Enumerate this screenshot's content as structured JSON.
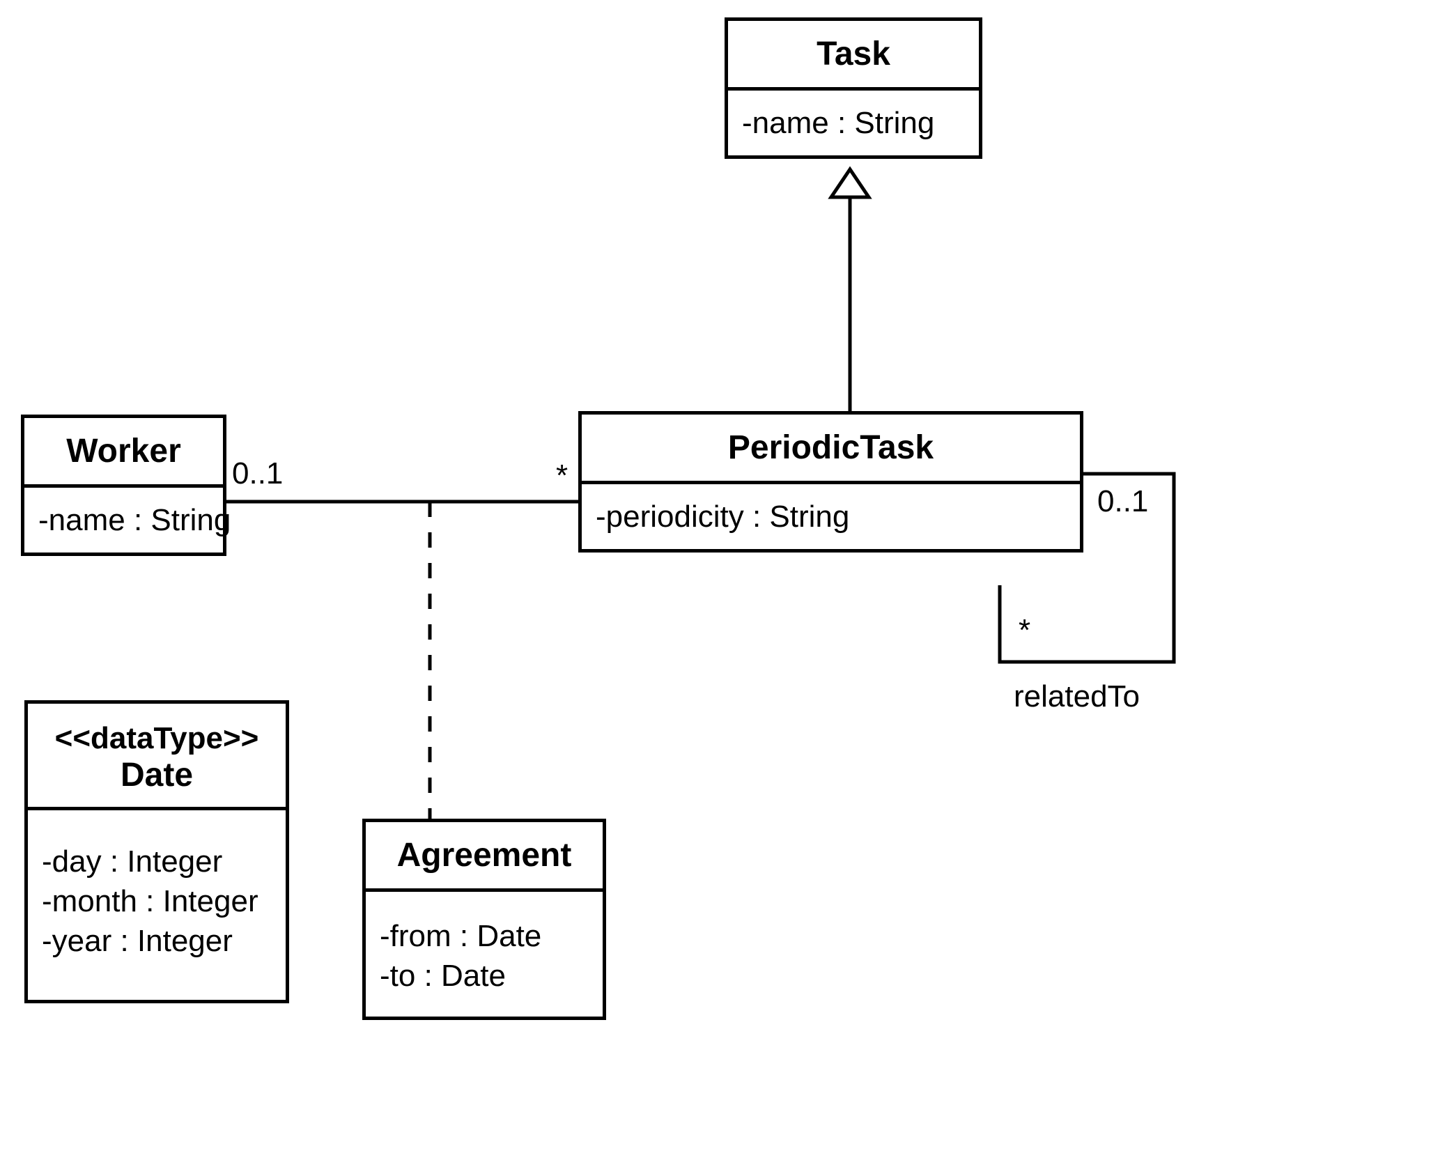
{
  "classes": {
    "task": {
      "name": "Task",
      "attributes": [
        "-name : String"
      ]
    },
    "worker": {
      "name": "Worker",
      "attributes": [
        "-name : String"
      ]
    },
    "periodicTask": {
      "name": "PeriodicTask",
      "attributes": [
        "-periodicity : String"
      ]
    },
    "date": {
      "stereotype": "<<dataType>>",
      "name": "Date",
      "attributes": [
        "-day : Integer",
        "-month : Integer",
        "-year : Integer"
      ]
    },
    "agreement": {
      "name": "Agreement",
      "attributes": [
        "-from : Date",
        "-to : Date"
      ]
    }
  },
  "labels": {
    "workerMult": "0..1",
    "periodicTaskMultLeft": "*",
    "periodicTaskSelfTop": "0..1",
    "periodicTaskSelfBottom": "*",
    "relatedTo": "relatedTo"
  },
  "chart_data": {
    "type": "uml-class-diagram",
    "title": "",
    "classes": [
      {
        "name": "Task",
        "stereotype": null,
        "attributes": [
          {
            "visibility": "-",
            "name": "name",
            "type": "String"
          }
        ]
      },
      {
        "name": "PeriodicTask",
        "stereotype": null,
        "attributes": [
          {
            "visibility": "-",
            "name": "periodicity",
            "type": "String"
          }
        ]
      },
      {
        "name": "Worker",
        "stereotype": null,
        "attributes": [
          {
            "visibility": "-",
            "name": "name",
            "type": "String"
          }
        ]
      },
      {
        "name": "Agreement",
        "stereotype": null,
        "attributes": [
          {
            "visibility": "-",
            "name": "from",
            "type": "Date"
          },
          {
            "visibility": "-",
            "name": "to",
            "type": "Date"
          }
        ]
      },
      {
        "name": "Date",
        "stereotype": "<<dataType>>",
        "attributes": [
          {
            "visibility": "-",
            "name": "day",
            "type": "Integer"
          },
          {
            "visibility": "-",
            "name": "month",
            "type": "Integer"
          },
          {
            "visibility": "-",
            "name": "year",
            "type": "Integer"
          }
        ]
      }
    ],
    "relationships": [
      {
        "type": "generalization",
        "child": "PeriodicTask",
        "parent": "Task"
      },
      {
        "type": "association",
        "end1": {
          "class": "Worker",
          "multiplicity": "0..1"
        },
        "end2": {
          "class": "PeriodicTask",
          "multiplicity": "*"
        },
        "associationClass": "Agreement"
      },
      {
        "type": "association",
        "name": "relatedTo",
        "end1": {
          "class": "PeriodicTask",
          "multiplicity": "0..1"
        },
        "end2": {
          "class": "PeriodicTask",
          "multiplicity": "*"
        }
      }
    ]
  }
}
